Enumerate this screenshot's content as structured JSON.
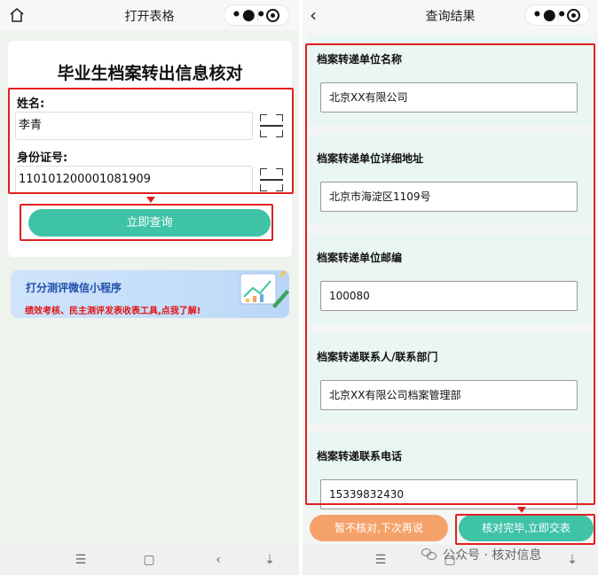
{
  "left_screen": {
    "topbar": {
      "title": "打开表格",
      "home_icon": "home-icon",
      "more_icon": "more-icon",
      "target_icon": "target-icon"
    },
    "form": {
      "heading": "毕业生档案转出信息核对",
      "name_label": "姓名:",
      "name_value": "李青",
      "id_label": "身份证号:",
      "id_value": "110101200001081909",
      "scan_icon": "scan-icon",
      "query_button": "立即查询"
    },
    "banner": {
      "title": "打分测评微信小程序",
      "subtitle": "绩效考核、民主测评发表收表工具,点我了解!"
    },
    "navbar": {
      "icons": [
        "menu-icon",
        "square-icon",
        "back-nav-icon",
        "down-arrows-icon"
      ]
    }
  },
  "right_screen": {
    "topbar": {
      "title": "查询结果",
      "back_icon": "back-icon",
      "more_icon": "more-icon",
      "target_icon": "target-icon"
    },
    "fields": [
      {
        "label": "档案转递单位名称",
        "value": "北京XX有限公司"
      },
      {
        "label": "档案转递单位详细地址",
        "value": "北京市海淀区1109号"
      },
      {
        "label": "档案转递单位邮编",
        "value": "100080"
      },
      {
        "label": "档案转递联系人/联系部门",
        "value": "北京XX有限公司档案管理部"
      },
      {
        "label": "档案转递联系电话",
        "value": "15339832430"
      }
    ],
    "buttons": {
      "later": "暂不核对,下次再说",
      "submit": "核对完毕,立即交表"
    }
  },
  "watermark": "公众号 · 核对信息",
  "colors": {
    "accent_green": "#3fc3a6",
    "accent_orange": "#f5a26a",
    "highlight_red": "#e02020"
  }
}
